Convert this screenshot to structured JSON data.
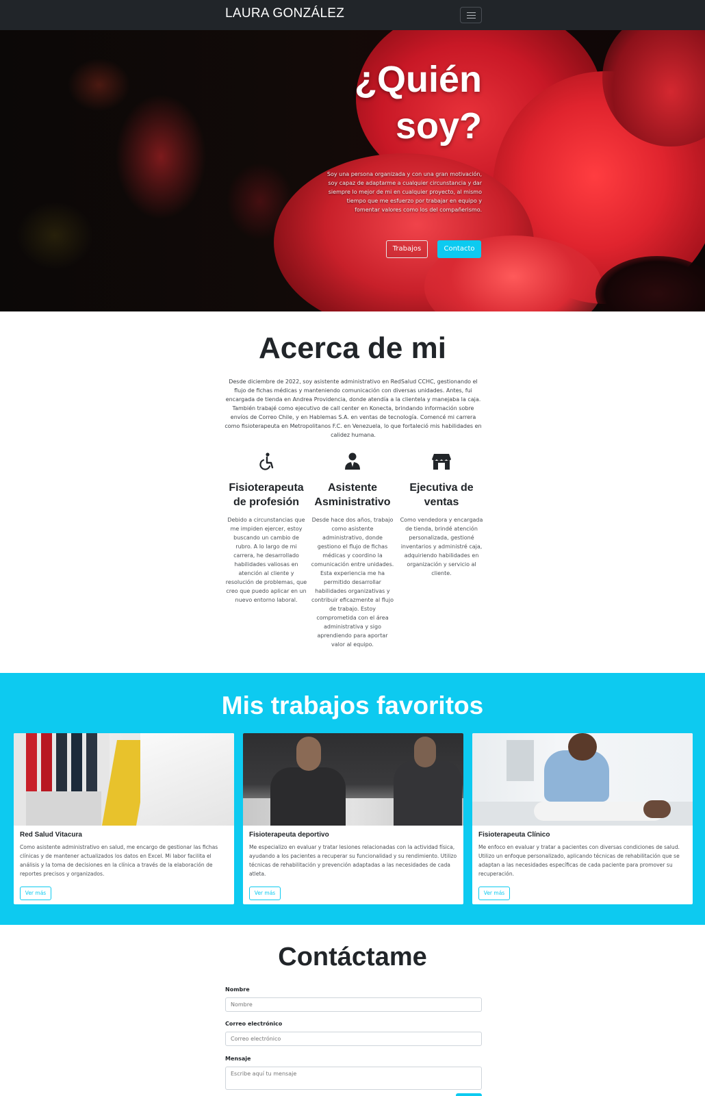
{
  "navbar": {
    "brand": "LAURA GONZÁLEZ",
    "toggle_icon": "hamburger-icon"
  },
  "hero": {
    "title_line1": "¿Quién",
    "title_line2": "soy?",
    "text": "Soy una persona organizada y con una gran motivación, soy capaz de adaptarme a cualquier circunstancia y dar siempre lo mejor de mi en cualquier proyecto, al mismo tiempo que me esfuerzo por trabajar en equipo y fomentar valores como los del compañerismo.",
    "btn_works": "Trabajos",
    "btn_contact": "Contacto"
  },
  "about": {
    "title": "Acerca de mi",
    "text": "Desde diciembre de 2022, soy asistente administrativo en RedSalud CCHC, gestionando el flujo de fichas médicas y manteniendo comunicación con diversas unidades. Antes, fui encargada de tienda en Andrea Providencia, donde atendía a la clientela y manejaba la caja. También trabajé como ejecutivo de call center en Konecta, brindando información sobre envíos de Correo Chile, y en Hablemas S.A. en ventas de tecnología. Comencé mi carrera como fisioterapeuta en Metropolitanos F.C. en Venezuela, lo que fortaleció mis habilidades en calidez humana.",
    "features": [
      {
        "icon": "wheelchair-icon",
        "title": "Fisioterapeuta de profesión",
        "text": "Debido a circunstancias que me impiden ejercer, estoy buscando un cambio de rubro. A lo largo de mi carrera, he desarrollado habilidades valiosas en atención al cliente y resolución de problemas, que creo que puedo aplicar en un nuevo entorno laboral."
      },
      {
        "icon": "person-suit-icon",
        "title": "Asistente Asministrativo",
        "text": "Desde hace dos años, trabajo como asistente administrativo, donde gestiono el flujo de fichas médicas y coordino la comunicación entre unidades. Esta experiencia me ha permitido desarrollar habilidades organizativas y contribuir eficazmente al flujo de trabajo. Estoy comprometida con el área administrativa y sigo aprendiendo para aportar valor al equipo."
      },
      {
        "icon": "shop-icon",
        "title": "Ejecutiva de ventas",
        "text": "Como vendedora y encargada de tienda, brindé atención personalizada, gestioné inventarios y administré caja, adquiriendo habilidades en organización y servicio al cliente."
      }
    ]
  },
  "works": {
    "title": "Mis trabajos favoritos",
    "cards": [
      {
        "title": "Red Salud Vitacura",
        "text": "Como asistente administrativo en salud, me encargo de gestionar las fichas clínicas y de mantener actualizados los datos en Excel. Mi labor facilita el análisis y la toma de decisiones en la clínica a través de la elaboración de reportes precisos y organizados.",
        "button": "Ver más"
      },
      {
        "title": "Fisioterapeuta deportivo",
        "text": "Me especializo en evaluar y tratar lesiones relacionadas con la actividad física, ayudando a los pacientes a recuperar su funcionalidad y su rendimiento. Utilizo técnicas de rehabilitación y prevención adaptadas a las necesidades de cada atleta.",
        "button": "Ver más"
      },
      {
        "title": "Fisioterapeuta Clínico",
        "text": "Me enfoco en evaluar y tratar a pacientes con diversas condiciones de salud. Utilizo un enfoque personalizado, aplicando técnicas de rehabilitación que se adaptan a las necesidades específicas de cada paciente para promover su recuperación.",
        "button": "Ver más"
      }
    ]
  },
  "contact": {
    "title": "Contáctame",
    "name_label": "Nombre",
    "name_placeholder": "Nombre",
    "email_label": "Correo electrónico",
    "email_placeholder": "Correo electrónico",
    "message_label": "Mensaje",
    "message_placeholder": "Escribe aquí tu mensaje"
  },
  "colors": {
    "navbar": "#212529",
    "accent": "#0dcaf0",
    "text": "#212529"
  }
}
